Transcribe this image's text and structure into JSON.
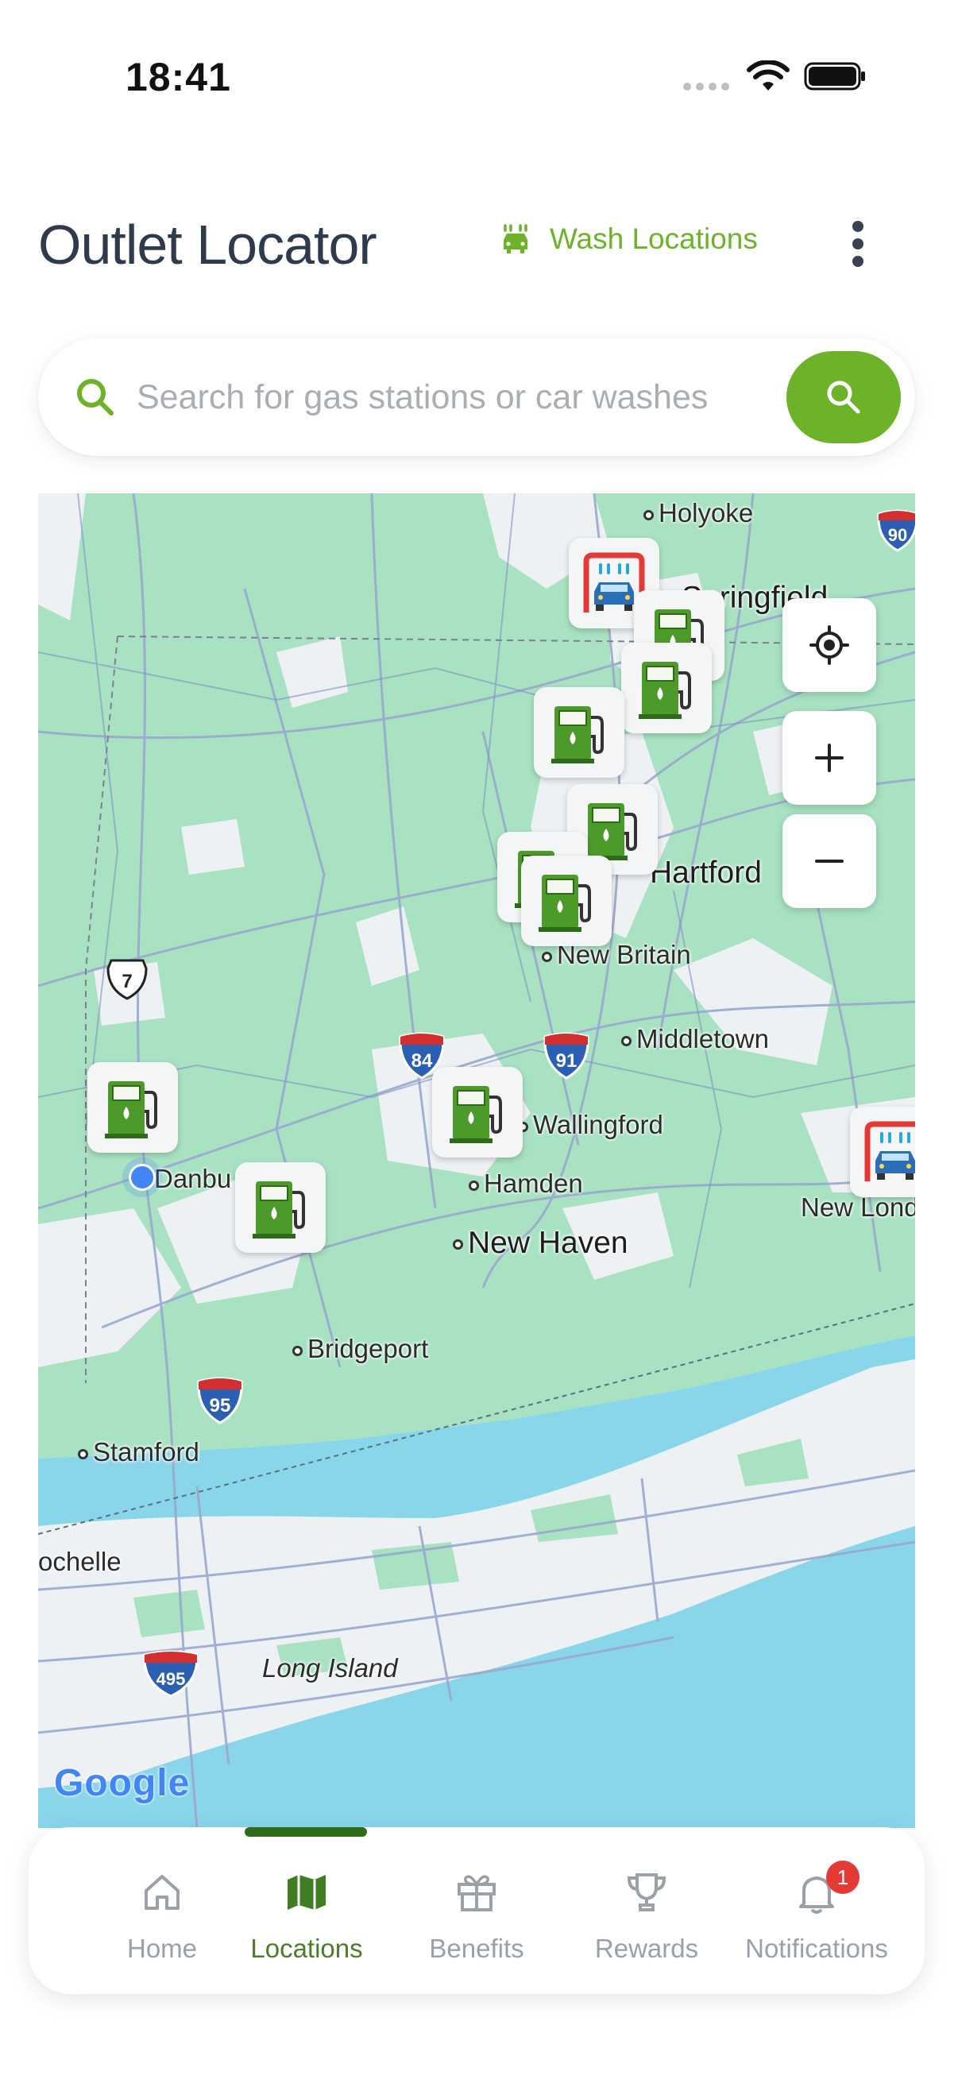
{
  "status_bar": {
    "time": "18:41"
  },
  "header": {
    "title": "Outlet Locator",
    "wash_link_label": "Wash Locations",
    "more_icon": "more-vertical-icon"
  },
  "search": {
    "placeholder": "Search for gas stations or car washes",
    "value": ""
  },
  "map": {
    "labels": {
      "holyoke": "Holyoke",
      "springfield": "Springfield",
      "hartford": "Hartford",
      "new_britain": "New Britain",
      "middletown": "Middletown",
      "wallingford": "Wallingford",
      "danbury": "Danbu",
      "hamden": "Hamden",
      "new_london": "New Lond",
      "new_haven": "New Haven",
      "bridgeport": "Bridgeport",
      "stamford": "Stamford",
      "rochelle": "ochelle",
      "long_island": "Long Island"
    },
    "shields": {
      "i90": "90",
      "us7": "7",
      "i84": "84",
      "i91": "91",
      "i95": "95",
      "i495": "495"
    },
    "attribution": "Google",
    "colors": {
      "land": "#eef1f4",
      "green": "#a8e2c2",
      "water": "#89d6ea",
      "road": "#9aa8cf",
      "accent": "#6db32a"
    }
  },
  "nav": {
    "items": [
      {
        "label": "Home",
        "icon": "home-icon"
      },
      {
        "label": "Locations",
        "icon": "map-icon"
      },
      {
        "label": "Benefits",
        "icon": "gift-icon"
      },
      {
        "label": "Rewards",
        "icon": "trophy-icon"
      },
      {
        "label": "Notifications",
        "icon": "bell-icon"
      }
    ],
    "active": "Locations",
    "notification_count": "1"
  }
}
